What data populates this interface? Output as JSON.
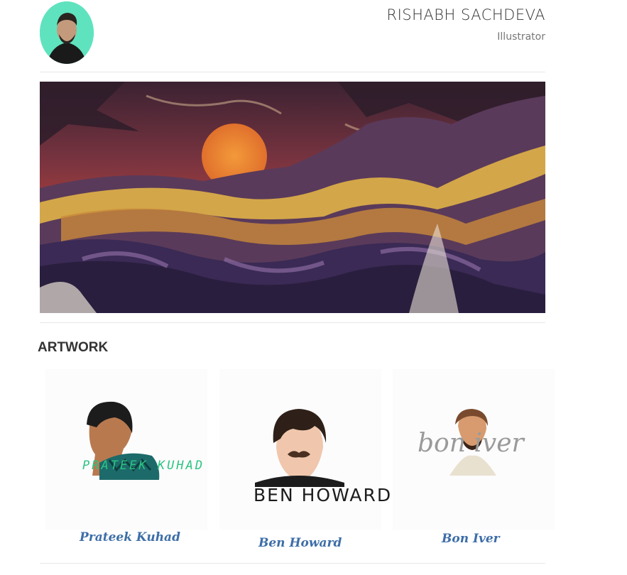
{
  "header": {
    "name": "RISHABH SACHDEVA",
    "role": "Illustrator",
    "avatar_bg": "#5fe3be"
  },
  "hero": {
    "icon": "mountain-sunset-illustration"
  },
  "artwork": {
    "title": "ARTWORK",
    "items": [
      {
        "title": "Prateek Kuhad",
        "poster_text": "PRATEEK KUHAD"
      },
      {
        "title": "Ben Howard",
        "poster_text": "BEN HOWARD"
      },
      {
        "title": "Bon Iver",
        "poster_text": "bon iver"
      }
    ]
  },
  "colors": {
    "link": "#3d6ea8",
    "text": "#333333",
    "muted": "#777777"
  }
}
